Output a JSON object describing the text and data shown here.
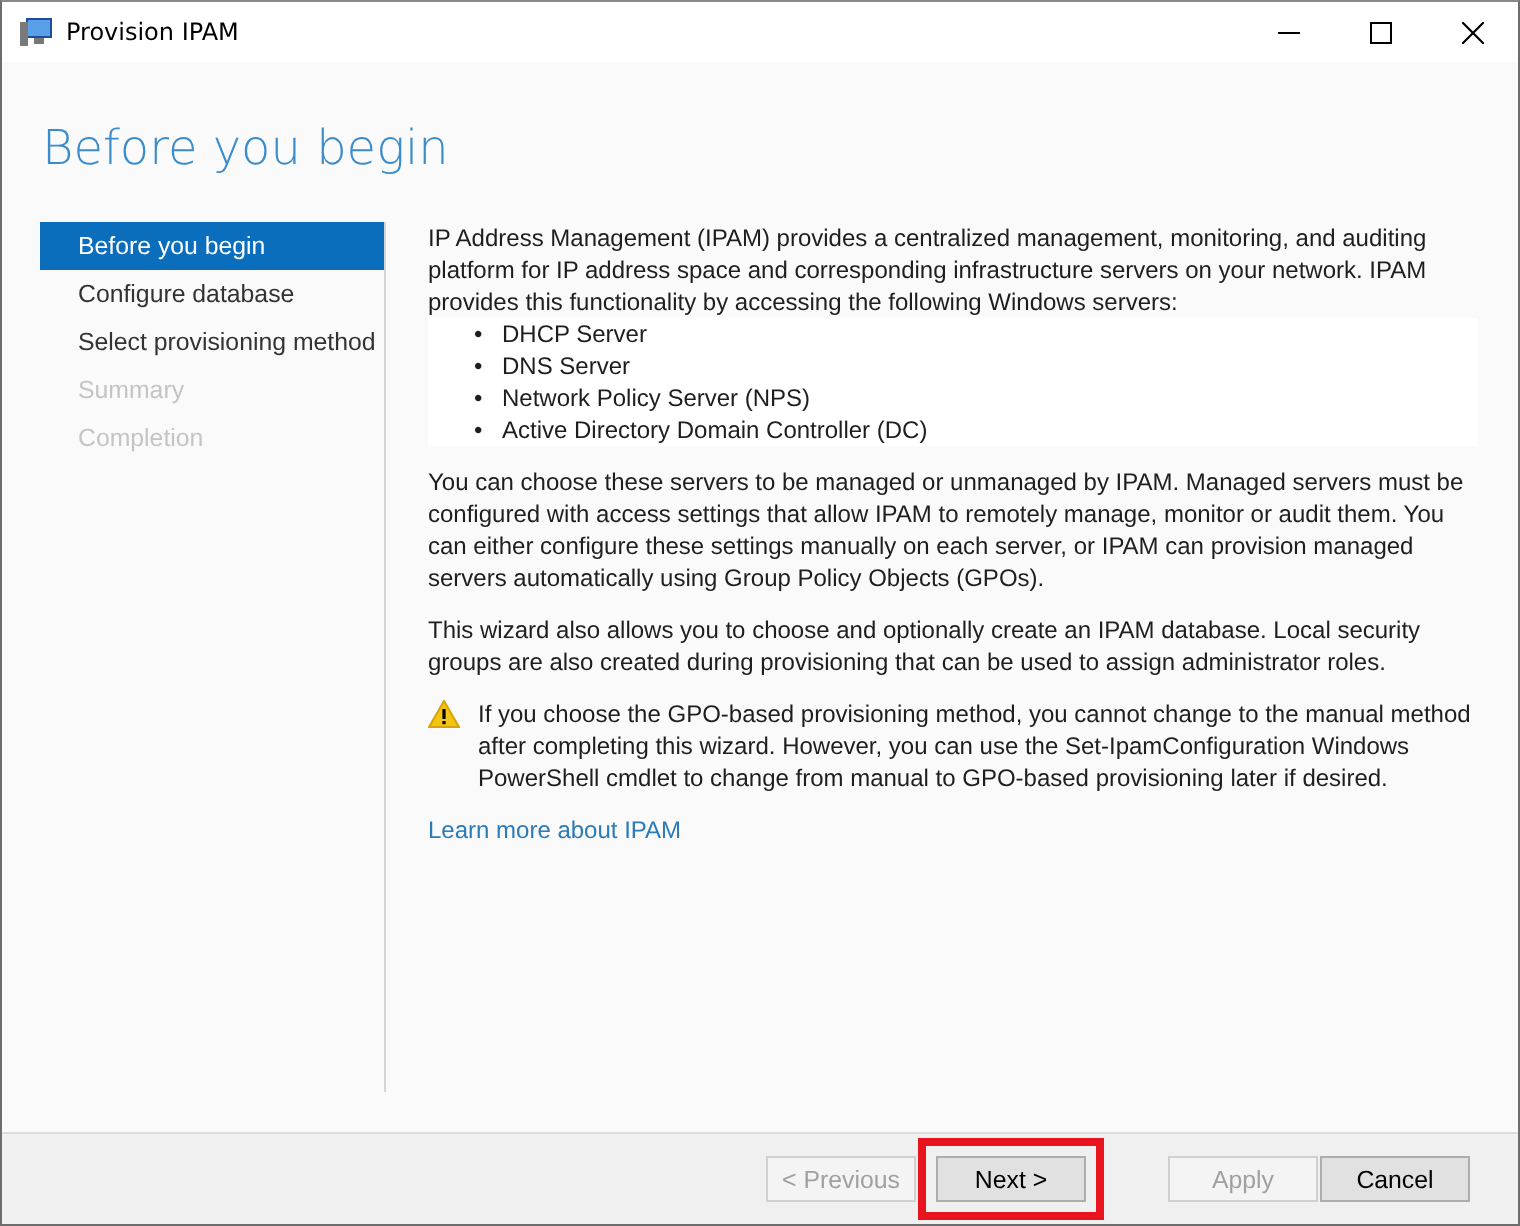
{
  "window": {
    "title": "Provision IPAM"
  },
  "page_title": "Before you begin",
  "steps": [
    {
      "label": "Before you begin",
      "selected": true,
      "disabled": false
    },
    {
      "label": "Configure database",
      "selected": false,
      "disabled": false
    },
    {
      "label": "Select provisioning method",
      "selected": false,
      "disabled": false
    },
    {
      "label": "Summary",
      "selected": false,
      "disabled": true
    },
    {
      "label": "Completion",
      "selected": false,
      "disabled": true
    }
  ],
  "content": {
    "intro": "IP Address Management (IPAM) provides a centralized management, monitoring, and auditing platform for IP address space and corresponding infrastructure servers on your network. IPAM provides this functionality by accessing the following Windows servers:",
    "servers": [
      "DHCP Server",
      "DNS Server",
      "Network Policy Server (NPS)",
      "Active Directory Domain Controller (DC)"
    ],
    "bullet": "•",
    "paragraphs": [
      "You can choose these servers to be managed or unmanaged by IPAM. Managed servers must be configured with access settings that allow IPAM to remotely manage, monitor or audit them. You can either configure these settings manually on each server, or IPAM can provision managed servers automatically using Group Policy Objects (GPOs).",
      "This wizard also allows you to choose and optionally create an IPAM database. Local security groups are also created during provisioning that can be used to assign administrator roles."
    ],
    "warning": "If you choose the GPO-based provisioning method, you cannot change to the manual method after completing this wizard. However, you can use the Set-IpamConfiguration Windows PowerShell cmdlet to change from manual to GPO-based provisioning later if desired.",
    "link": "Learn more about IPAM"
  },
  "buttons": [
    {
      "label": "< Previous",
      "disabled": true,
      "highlighted": false
    },
    {
      "label": "Next >",
      "disabled": false,
      "highlighted": true
    },
    {
      "label": "Apply",
      "disabled": true,
      "highlighted": false
    },
    {
      "label": "Cancel",
      "disabled": false,
      "highlighted": false
    }
  ]
}
